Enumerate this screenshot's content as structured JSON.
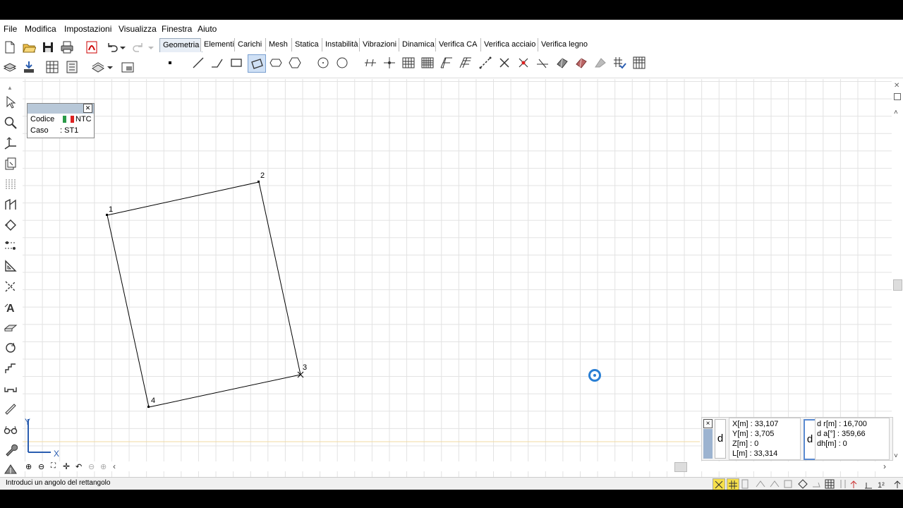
{
  "menu": {
    "file": "File",
    "modifica": "Modifica",
    "impostazioni": "Impostazioni",
    "visualizza": "Visualizza",
    "finestra": "Finestra",
    "aiuto": "Aiuto"
  },
  "tabs": [
    "Geometria",
    "Elementi",
    "Carichi",
    "Mesh",
    "Statica",
    "Instabilità",
    "Vibrazioni",
    "Dinamica",
    "Verifica CA",
    "Verifica acciaio",
    "Verifica legno"
  ],
  "active_tab": "Geometria",
  "info_box": {
    "codice_label": "Codice",
    "codice_value": "NTC",
    "caso_label": "Caso",
    "caso_value": ": ST1"
  },
  "nodes": [
    {
      "label": "1"
    },
    {
      "label": "2"
    },
    {
      "label": "3"
    },
    {
      "label": "4"
    }
  ],
  "axes": {
    "x": "X",
    "y": "Y"
  },
  "coords": {
    "x": "X[m] : 33,107",
    "y": "Y[m] : 3,705",
    "z": "Z[m] : 0",
    "l": "L[m] : 33,314",
    "dr": "d r[m] : 16,700",
    "da": "d a[°] : 359,66",
    "dh": "dh[m] : 0",
    "d_left": "d",
    "d_right": "d",
    "close": "×"
  },
  "status": {
    "message": "Introduci un angolo del rettangolo"
  },
  "colors": {
    "accent": "#3a7bd5",
    "tab_active_bg": "#e8eef6",
    "grid": "#e2e2e2",
    "cursor_ring": "#2a7fd4"
  }
}
